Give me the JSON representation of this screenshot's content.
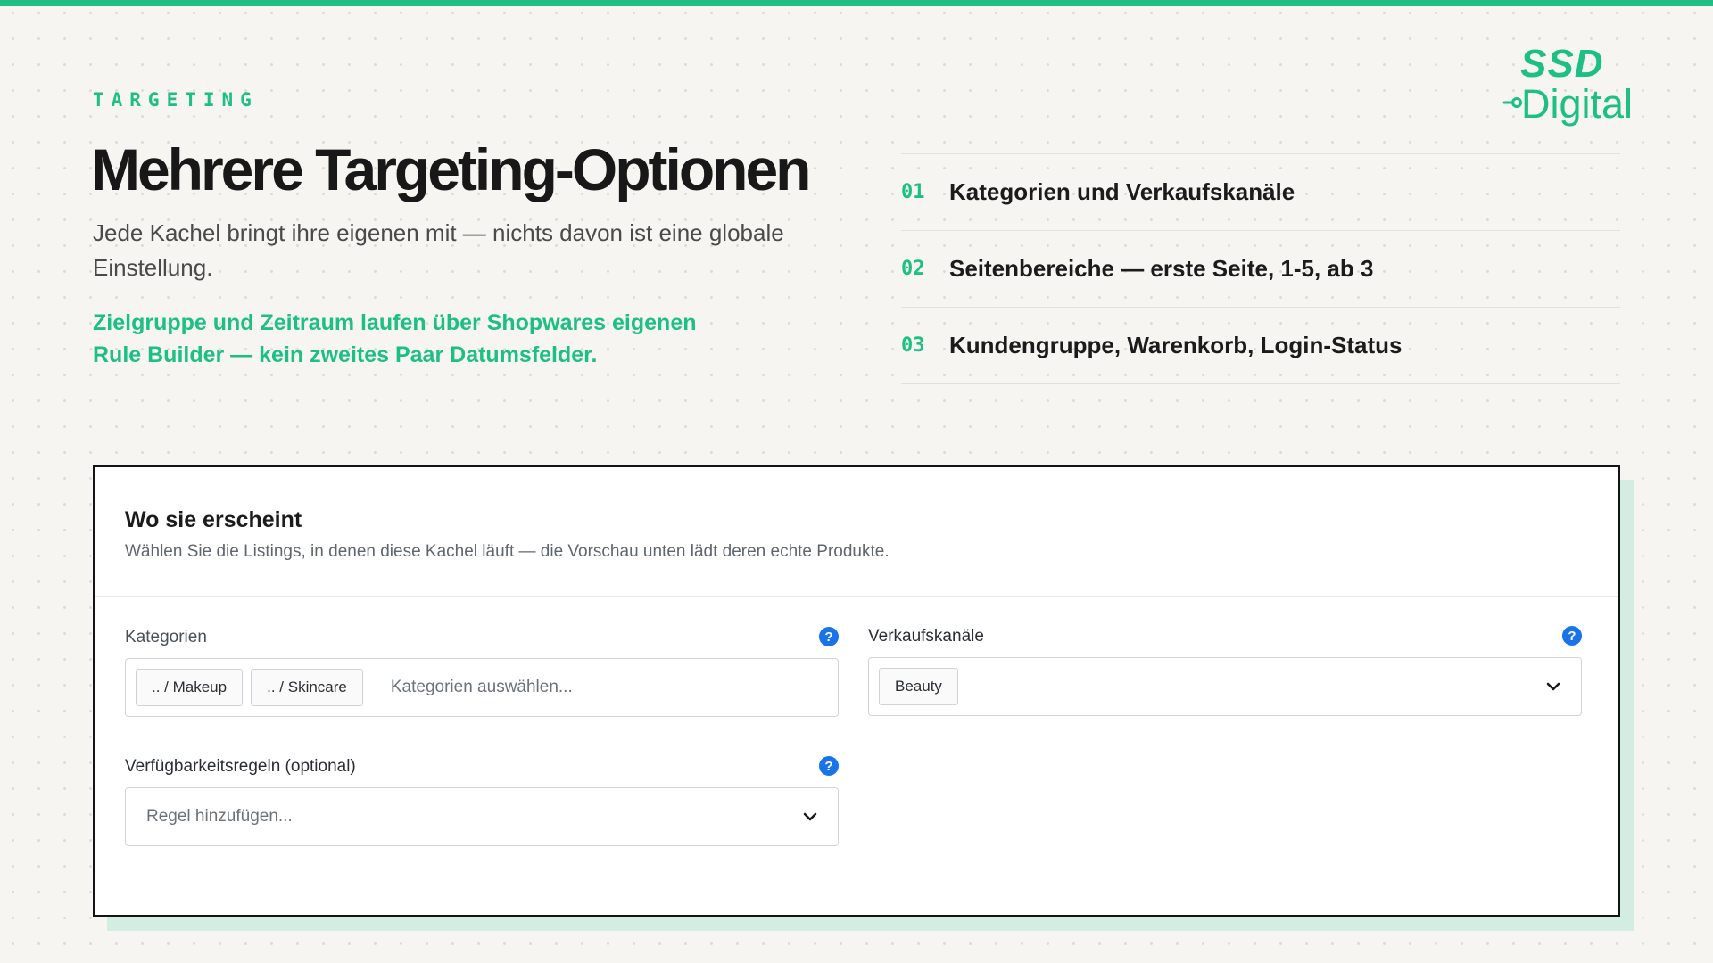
{
  "eyebrow": "TARGETING",
  "title": "Mehrere Targeting-Optionen",
  "subtitle": "Jede Kachel bringt ihre eigenen mit — nichts davon ist eine globale Einstellung.",
  "note": "Zielgruppe und Zeitraum laufen über Shopwares eigenen Rule Builder — kein zweites Paar Datumsfelder.",
  "logo": {
    "line1": "SSD",
    "line2": "Digital"
  },
  "features": [
    {
      "num": "01",
      "text": "Kategorien und Verkaufskanäle"
    },
    {
      "num": "02",
      "text": "Seitenbereiche — erste Seite, 1-5, ab 3"
    },
    {
      "num": "03",
      "text": "Kundengruppe, Warenkorb, Login-Status"
    }
  ],
  "panel": {
    "title": "Wo sie erscheint",
    "description": "Wählen Sie die Listings, in denen diese Kachel läuft — die Vorschau unten lädt deren echte Produkte.",
    "categories": {
      "label": "Kategorien",
      "chips": [
        ".. / Makeup",
        ".. / Skincare"
      ],
      "placeholder": "Kategorien auswählen...",
      "help": "?"
    },
    "sales_channels": {
      "label": "Verkaufskanäle",
      "chips": [
        "Beauty"
      ],
      "help": "?"
    },
    "availability_rules": {
      "label": "Verfügbarkeitsregeln (optional)",
      "placeholder": "Regel hinzufügen...",
      "help": "?"
    }
  },
  "colors": {
    "accent": "#1dbf82",
    "help_icon": "#1a73e8",
    "panel_shadow": "#d4ede2",
    "background": "#f6f5f1"
  },
  "icons": {
    "help": "question-circle-icon",
    "dropdown": "chevron-down-icon",
    "logo_plug": "plug-icon"
  }
}
